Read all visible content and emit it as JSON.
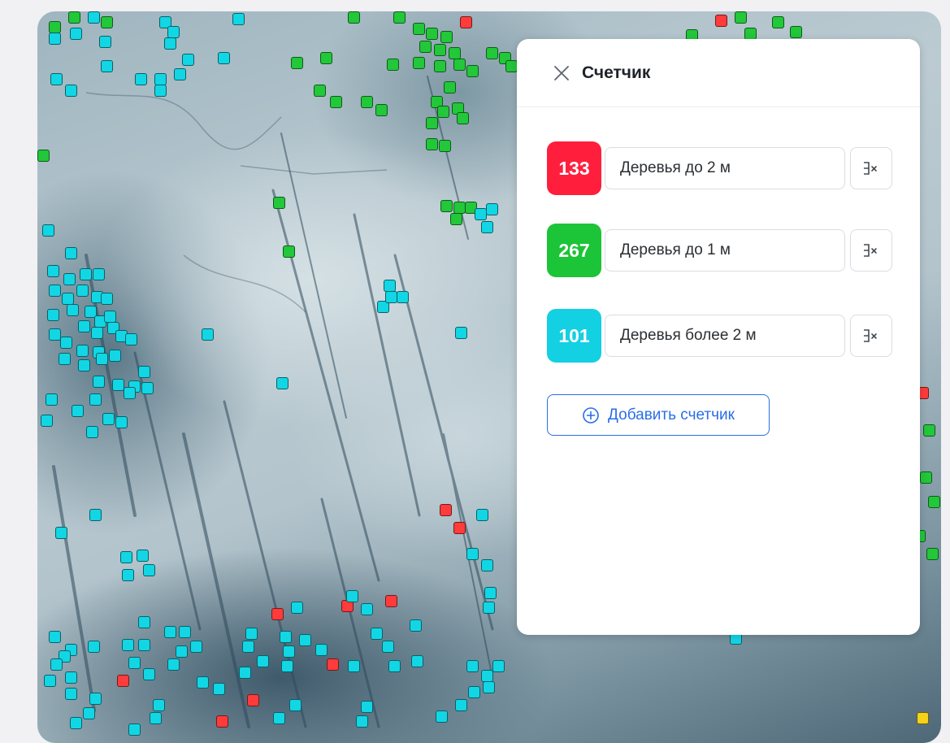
{
  "panel": {
    "title": "Счетчик",
    "close_icon": "close-icon",
    "counters": [
      {
        "count": "133",
        "label": "Деревья до 2 м",
        "color": "#ff1f3d"
      },
      {
        "count": "267",
        "label": "Деревья до 1 м",
        "color": "#1cc437"
      },
      {
        "count": "101",
        "label": "Деревья более 2 м",
        "color": "#13d0e2"
      }
    ],
    "clear_icon": "clear-filter-icon",
    "add_button": {
      "icon": "add-circle-icon",
      "label": "Добавить счетчик"
    }
  },
  "map": {
    "marker_colors": {
      "red": "#ff3b3b",
      "green": "#22c73a",
      "cyan": "#13d6e4",
      "yellow": "#f3d21a"
    }
  }
}
